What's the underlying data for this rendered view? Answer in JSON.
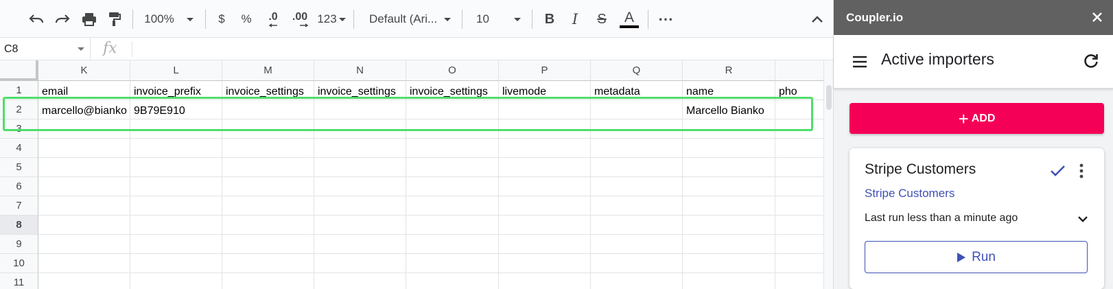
{
  "toolbar": {
    "undo_icon": "undo-icon",
    "redo_icon": "redo-icon",
    "print_icon": "print-icon",
    "paint_format_icon": "paint-format-icon",
    "zoom": "100%",
    "currency": "$",
    "percent": "%",
    "decrease_decimal": ".0",
    "increase_decimal": ".00",
    "number_format": "123",
    "font": "Default (Ari...",
    "font_size": "10",
    "bold": "B",
    "italic": "I",
    "strikethrough": "S",
    "text_color": "A",
    "more": "⋯"
  },
  "formula_bar": {
    "cell_ref": "C8",
    "fx_label": "fx",
    "value": ""
  },
  "grid": {
    "columns": [
      "K",
      "L",
      "M",
      "N",
      "O",
      "P",
      "Q",
      "R",
      ""
    ],
    "rows": [
      "1",
      "2",
      "3",
      "4",
      "5",
      "6",
      "7",
      "8",
      "9",
      "10",
      "11"
    ],
    "selected_row": "8",
    "row1": [
      "email",
      "invoice_prefix",
      "invoice_settings",
      "invoice_settings",
      "invoice_settings",
      "livemode",
      "metadata",
      "name",
      "pho"
    ],
    "row2": [
      "marcello@bianko",
      "9B79E910",
      "",
      "",
      "",
      "",
      "",
      "Marcello Bianko",
      ""
    ]
  },
  "panel": {
    "app_title": "Coupler.io",
    "header_title": "Active importers",
    "add_label": "ADD",
    "card": {
      "title": "Stripe Customers",
      "link": "Stripe Customers",
      "status": "Last run less than a minute ago",
      "run_label": "Run"
    },
    "colors": {
      "title_bar": "#616161",
      "add_button": "#f50057",
      "accent": "#3f51b5",
      "highlight": "#4ede6a"
    }
  }
}
